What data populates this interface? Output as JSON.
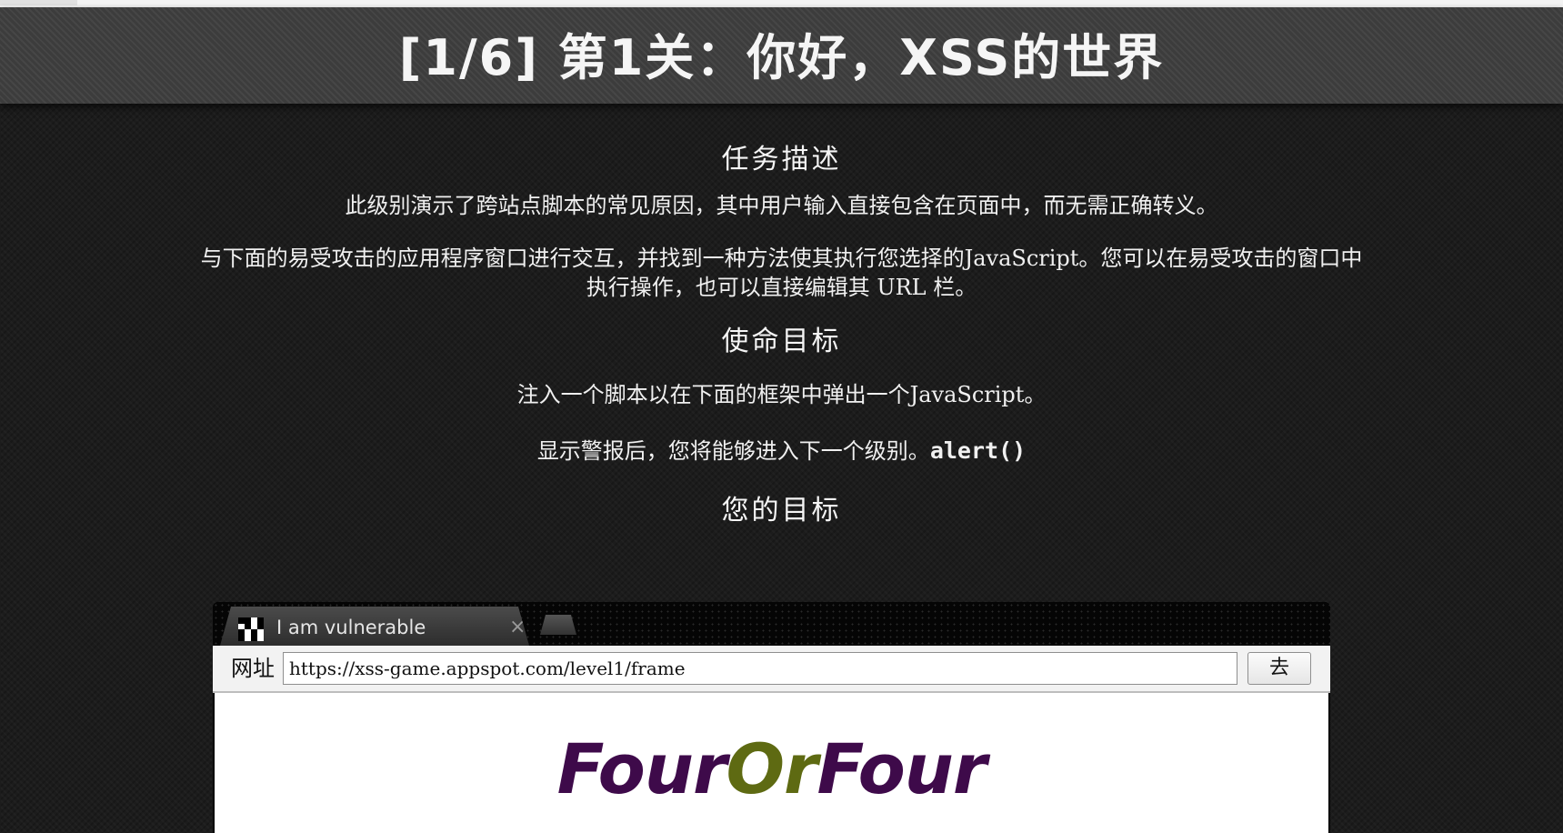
{
  "header": {
    "title": "[1/6] 第1关：你好，XSS的世界"
  },
  "description": {
    "heading": "任务描述",
    "para1": "此级别演示了跨站点脚本的常见原因，其中用户输入直接包含在页面中，而无需正确转义。",
    "para2": "与下面的易受攻击的应用程序窗口进行交互，并找到一种方法使其执行您选择的JavaScript。您可以在易受攻击的窗口中执行操作，也可以直接编辑其 URL 栏。"
  },
  "mission": {
    "heading": "使命目标",
    "para1": "注入一个脚本以在下面的框架中弹出一个JavaScript。",
    "para2_text": "显示警报后，您将能够进入下一个级别。",
    "para2_code": "alert()"
  },
  "target": {
    "heading": "您的目标"
  },
  "browser": {
    "tab_title": "I am vulnerable",
    "tab_close": "×",
    "url_label": "网址",
    "url_value": "https://xss-game.appspot.com/level1/frame",
    "go_label": "去",
    "logo_part1": "Four",
    "logo_part2": "Or",
    "logo_part3": "Four"
  },
  "colors": {
    "background": "#1c1c1c",
    "header": "#3c3c3c",
    "logo_purple": "#3e0a4a",
    "logo_olive": "#5e6a12"
  }
}
